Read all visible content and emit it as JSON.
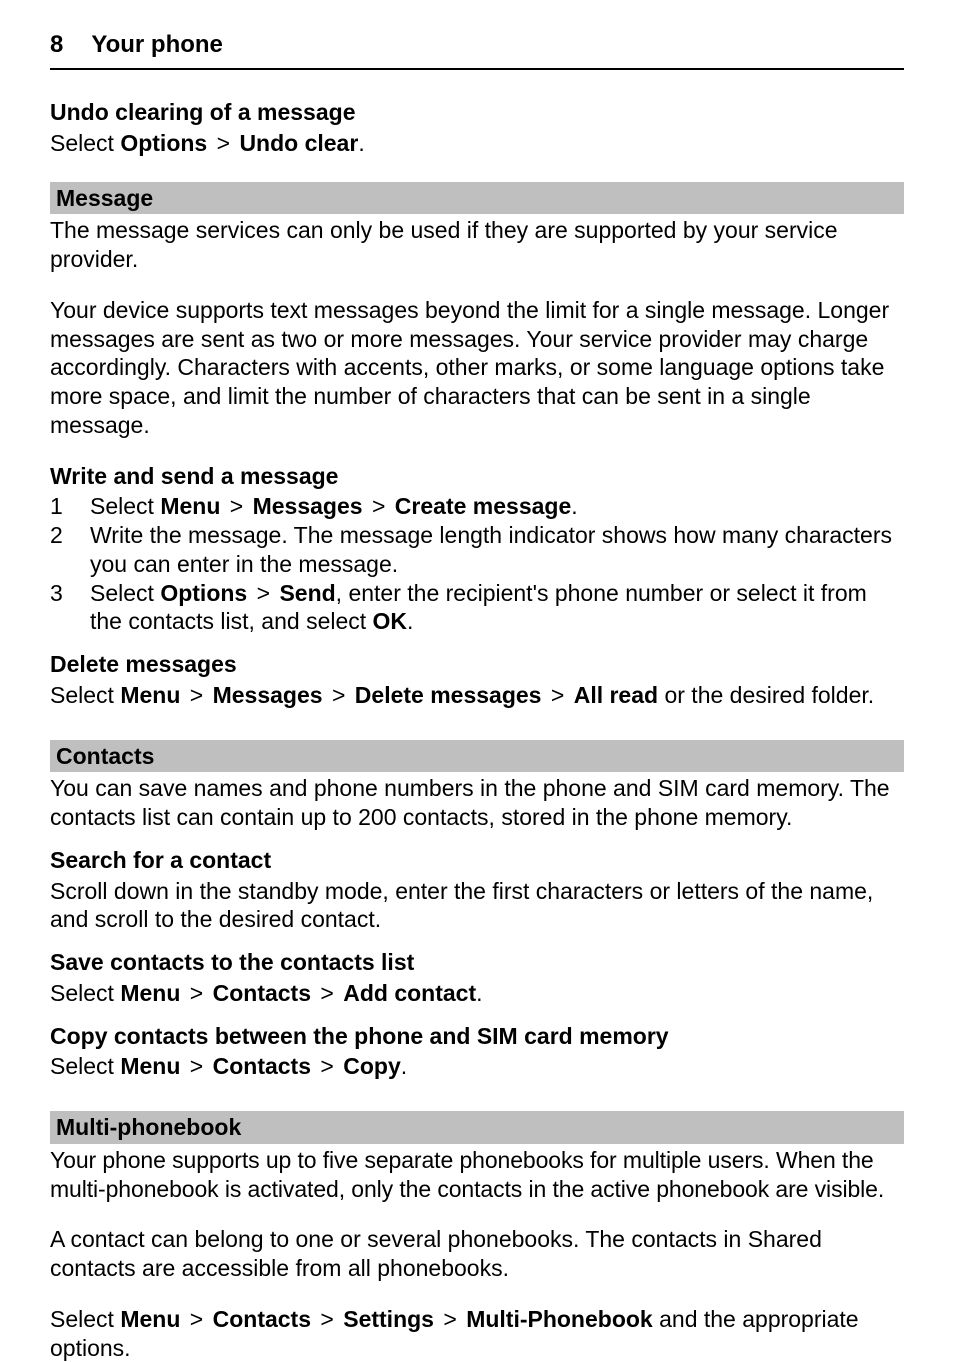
{
  "header": {
    "page_no": "8",
    "title": "Your phone"
  },
  "undo": {
    "heading": "Undo clearing of a message",
    "pre": "Select ",
    "options": "Options",
    "gt": " > ",
    "undo_clear": "Undo clear",
    "period": "."
  },
  "message": {
    "bar": "Message",
    "p1": "The message services can only be used if they are supported by your service provider.",
    "p2": "Your device supports text messages beyond the limit for a single message. Longer messages are sent as two or more messages. Your service provider may charge accordingly. Characters with accents, other marks, or some language options take more space, and limit the number of characters that can be sent in a single message.",
    "write_heading": "Write and send a message",
    "steps": {
      "n1": "1",
      "s1_pre": "Select ",
      "s1_menu": "Menu",
      "s1_gt1": " > ",
      "s1_messages": "Messages",
      "s1_gt2": " > ",
      "s1_create": "Create message",
      "s1_period": ".",
      "n2": "2",
      "s2": "Write the message. The message length indicator shows how many characters you can enter in the message.",
      "n3": "3",
      "s3_pre": "Select ",
      "s3_options": "Options",
      "s3_gt": " > ",
      "s3_send": "Send",
      "s3_mid": ", enter the recipient's phone number or select it from the contacts list, and select ",
      "s3_ok": "OK",
      "s3_period": "."
    },
    "delete_heading": "Delete messages",
    "del_pre": "Select ",
    "del_menu": "Menu",
    "del_gt1": " > ",
    "del_messages": "Messages",
    "del_gt2": " > ",
    "del_delete": "Delete messages",
    "del_gt3": " > ",
    "del_allread": "All read",
    "del_tail": " or the desired folder."
  },
  "contacts": {
    "bar": "Contacts",
    "p1": "You can save names and phone numbers in the phone and SIM card memory. The contacts list can contain up to 200 contacts, stored in the phone memory.",
    "search_heading": "Search for a contact",
    "search_body": "Scroll down in the standby mode, enter the first characters or letters of the name, and scroll to the desired contact.",
    "save_heading": "Save contacts to the contacts list",
    "save_pre": "Select ",
    "save_menu": "Menu",
    "save_gt1": " > ",
    "save_contacts": "Contacts",
    "save_gt2": " > ",
    "save_add": "Add contact",
    "save_period": ".",
    "copy_heading": "Copy contacts between the phone and SIM card memory",
    "copy_pre": "Select ",
    "copy_menu": "Menu",
    "copy_gt1": " > ",
    "copy_contacts": "Contacts",
    "copy_gt2": " > ",
    "copy_copy": "Copy",
    "copy_period": "."
  },
  "multi": {
    "bar": "Multi-phonebook",
    "p1": "Your phone supports up to five separate phonebooks for multiple users. When the multi-phonebook is activated, only the contacts in the active phonebook are visible.",
    "p2": "A contact can belong to one or several phonebooks. The contacts in Shared contacts are accessible from all phonebooks.",
    "sel_pre": "Select ",
    "sel_menu": "Menu",
    "sel_gt1": " > ",
    "sel_contacts": "Contacts",
    "sel_gt2": " > ",
    "sel_settings": "Settings",
    "sel_gt3": " > ",
    "sel_multi": "Multi-Phonebook",
    "sel_tail": " and the appropriate options."
  }
}
